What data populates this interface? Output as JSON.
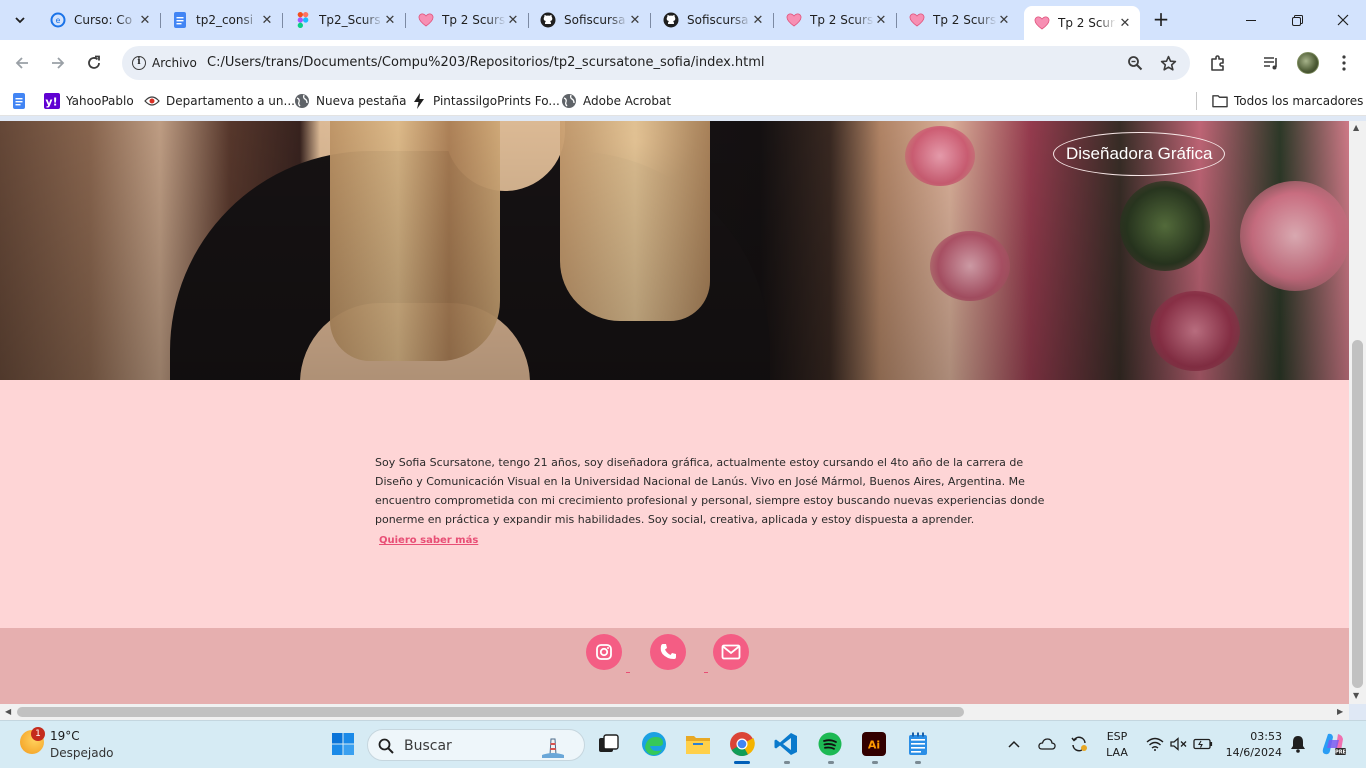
{
  "browser": {
    "tabs": [
      {
        "title": "Curso: Co",
        "icon": "course-icon",
        "color": "#1a73e8"
      },
      {
        "title": "tp2_consi",
        "icon": "docs-icon",
        "color": "#4285f4"
      },
      {
        "title": "Tp2_Scurs",
        "icon": "figma-icon",
        "color": "#f24e1e"
      },
      {
        "title": "Tp 2 Scurs",
        "icon": "heart-icon",
        "color": "#f06595"
      },
      {
        "title": "Sofiscursa",
        "icon": "github-icon",
        "color": "#1f1f1f"
      },
      {
        "title": "Sofiscursa",
        "icon": "github-icon",
        "color": "#1f1f1f"
      },
      {
        "title": "Tp 2 Scurs",
        "icon": "heart-icon",
        "color": "#f06595"
      },
      {
        "title": "Tp 2 Scurs",
        "icon": "heart-icon",
        "color": "#f06595"
      },
      {
        "title": "Tp 2 Scurs",
        "icon": "heart-icon",
        "color": "#f06595",
        "active": true
      }
    ],
    "site_chip": "Archivo",
    "url": "C:/Users/trans/Documents/Compu%203/Repositorios/tp2_scursatone_sofia/index.html",
    "bookmarks": [
      {
        "label": "",
        "icon": "docs-icon"
      },
      {
        "label": "YahooPablo",
        "icon": "yahoo-icon"
      },
      {
        "label": "Departamento a un...",
        "icon": "eye-icon"
      },
      {
        "label": "Nueva pestaña",
        "icon": "globe-icon"
      },
      {
        "label": "PintassilgoPrints Fo...",
        "icon": "bolt-icon"
      },
      {
        "label": "Adobe Acrobat",
        "icon": "globe-icon"
      }
    ],
    "all_bookmarks": "Todos los marcadores"
  },
  "page": {
    "hero_badge": "Diseñadora Gráfica",
    "about": "Soy Sofia Scursatone, tengo 21 años, soy diseñadora gráfica, actualmente estoy cursando el 4to año de la carrera de Diseño y Comunicación Visual en la Universidad Nacional de Lanús. Vivo en José Mármol, Buenos Aires, Argentina. Me encuentro comprometida con mi crecimiento profesional y personal, siempre estoy buscando nuevas experiencias donde ponerme en práctica y expandir mis habilidades. Soy social, creativa, aplicada y estoy dispuesta a aprender.",
    "more_link": "Quiero saber más",
    "social": [
      "instagram-icon",
      "phone-icon",
      "mail-icon"
    ],
    "colors": {
      "bg": "#fed5d6",
      "footer": "#e6afaf",
      "accent": "#f45d84",
      "link": "#e84e75"
    }
  },
  "taskbar": {
    "weather_badge": "1",
    "temperature": "19°C",
    "condition": "Despejado",
    "search_label": "Buscar",
    "language": "ESP",
    "layout": "LAA",
    "time": "03:53",
    "date": "14/6/2024"
  }
}
